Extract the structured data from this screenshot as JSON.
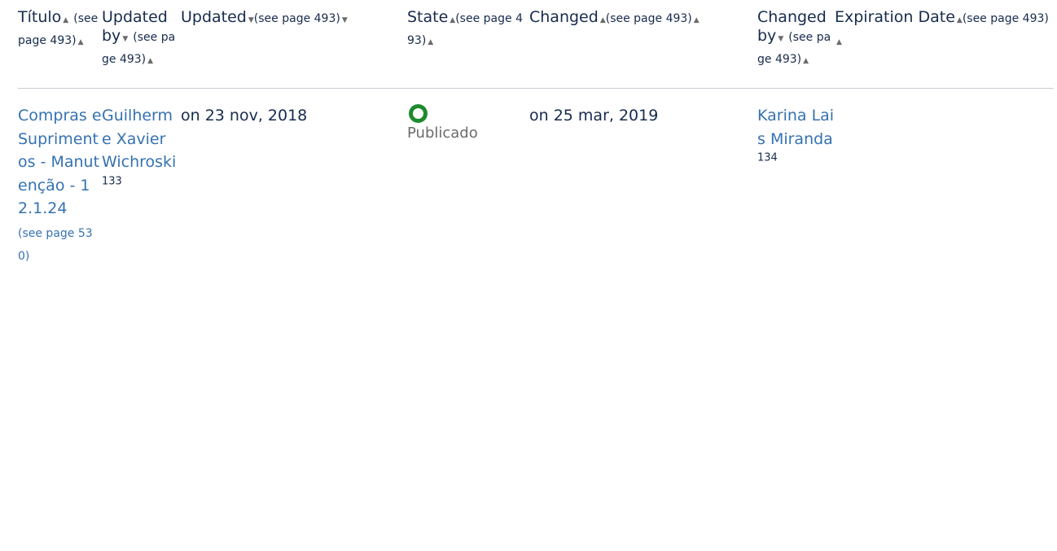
{
  "headers": {
    "titulo": {
      "label": "Título",
      "ref": "(see page 493)"
    },
    "updated_by": {
      "label": "Updated by",
      "ref": "(see page 493)"
    },
    "updated": {
      "label": "Updated",
      "ref": "(see page 493)"
    },
    "state": {
      "label": "State",
      "ref": "(see page 493)"
    },
    "changed": {
      "label": "Changed",
      "ref": "(see page 493)"
    },
    "changed_by": {
      "label": "Changed by",
      "ref": "(see page 493)"
    },
    "expiration": {
      "label": "Expiration Date",
      "ref": "(see page 493)"
    }
  },
  "rows": [
    {
      "title": "Compras e Suprimentos - Manutenção - 12.1.24",
      "title_ref": "(see page 530)",
      "updated_by": "Guilherme Xavier Wichroski",
      "updated_by_footnote": "133",
      "updated": "on 23 nov, 2018",
      "state": "Publicado",
      "changed": "on 25 mar, 2019",
      "changed_by": "Karina Lais Miranda",
      "changed_by_footnote": "134",
      "expiration": ""
    }
  ],
  "colors": {
    "link": "#3572b0",
    "status_published": "#1e8a2e"
  },
  "icons": {
    "sort_up": "sort-up-triangle-icon",
    "sort_down": "sort-down-triangle-icon",
    "status": "status-ring-icon"
  }
}
